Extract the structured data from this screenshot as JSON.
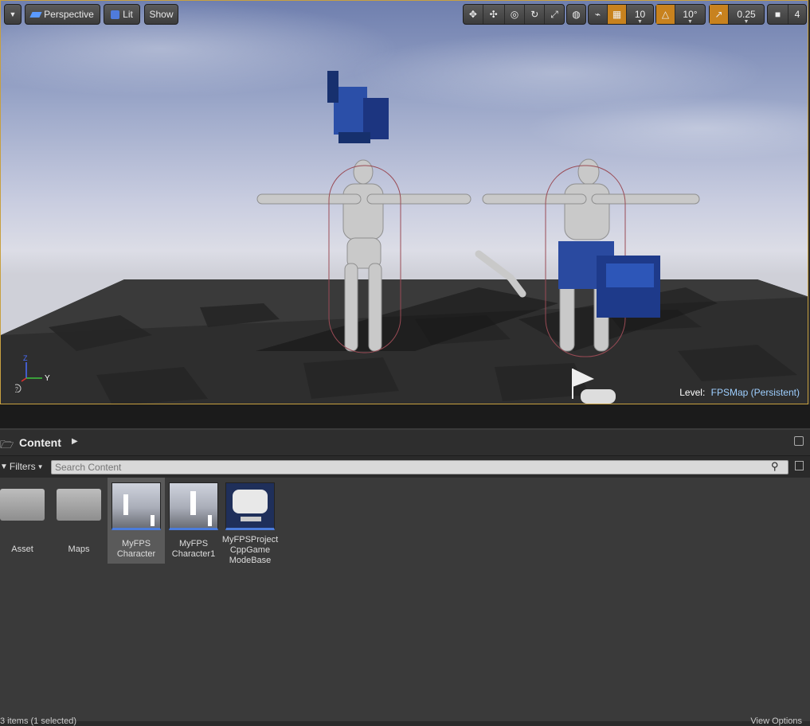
{
  "viewport": {
    "view_mode": "Perspective",
    "lighting": "Lit",
    "show": "Show",
    "grid_snap": "10",
    "rotation_snap": "10°",
    "scale_snap": "0.25",
    "camera_speed": "4",
    "level_label": "Level:",
    "level_name": "FPSMap (Persistent)",
    "axis_z": "Z",
    "axis_y": "Y",
    "accent": "#c8821e"
  },
  "content_browser": {
    "title": "Content",
    "filters_label": "Filters",
    "search_placeholder": "Search Content",
    "assets": [
      {
        "name": "Asset",
        "type": "folder"
      },
      {
        "name": "Maps",
        "type": "folder"
      },
      {
        "name": "MyFPS Character",
        "line1": "MyFPS",
        "line2": "Character",
        "type": "blueprint",
        "selected": true
      },
      {
        "name": "MyFPS Character1",
        "line1": "MyFPS",
        "line2": "Character1",
        "type": "blueprint"
      },
      {
        "name": "MyFPSProject CppGame ModeBase",
        "line1": "MyFPSProject",
        "line2": "CppGame",
        "line3": "ModeBase",
        "type": "gamemode"
      }
    ],
    "status_text": "3 items (1 selected)",
    "view_options": "View Options"
  }
}
